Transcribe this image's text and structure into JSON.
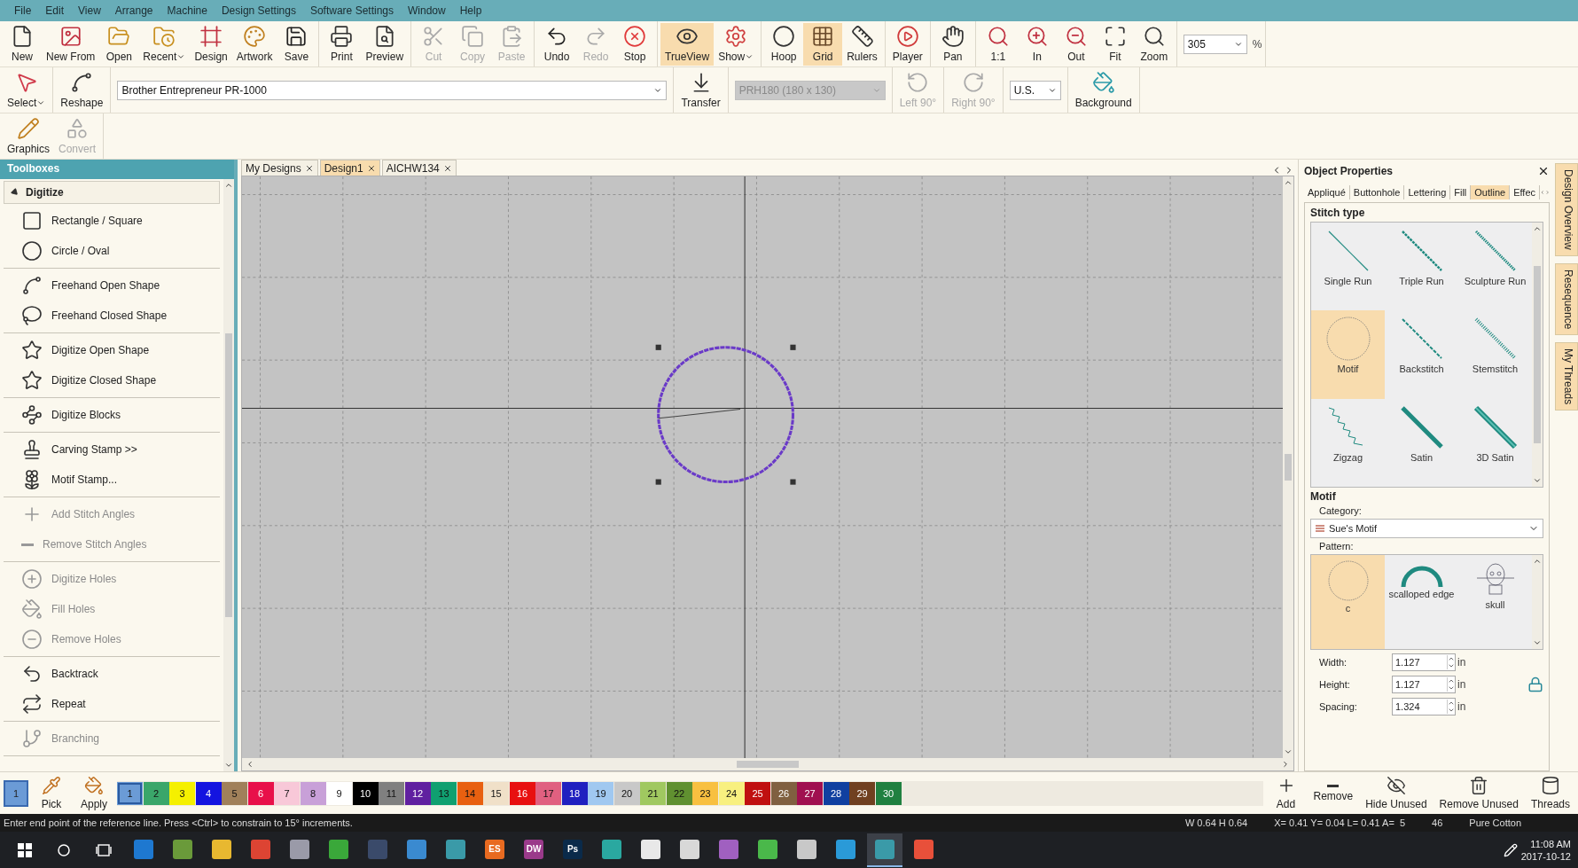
{
  "menu": [
    "File",
    "Edit",
    "View",
    "Arrange",
    "Machine",
    "Design Settings",
    "Software Settings",
    "Window",
    "Help"
  ],
  "toolbar": [
    [
      {
        "label": "New",
        "disabled": false,
        "selected": false,
        "dropdown": false
      },
      {
        "label": "New From",
        "disabled": false,
        "selected": false,
        "dropdown": false
      },
      {
        "label": "Open",
        "disabled": false,
        "selected": false,
        "dropdown": false
      },
      {
        "label": "Recent",
        "disabled": false,
        "selected": false,
        "dropdown": true
      },
      {
        "label": "Design",
        "disabled": false,
        "selected": false,
        "dropdown": false
      },
      {
        "label": "Artwork",
        "disabled": false,
        "selected": false,
        "dropdown": false
      },
      {
        "label": "Save",
        "disabled": false,
        "selected": false,
        "dropdown": false
      }
    ],
    [
      {
        "label": "Print",
        "disabled": false,
        "selected": false,
        "dropdown": false
      },
      {
        "label": "Preview",
        "disabled": false,
        "selected": false,
        "dropdown": false
      }
    ],
    [
      {
        "label": "Cut",
        "disabled": true,
        "selected": false,
        "dropdown": false
      },
      {
        "label": "Copy",
        "disabled": true,
        "selected": false,
        "dropdown": false
      },
      {
        "label": "Paste",
        "disabled": true,
        "selected": false,
        "dropdown": false
      }
    ],
    [
      {
        "label": "Undo",
        "disabled": false,
        "selected": false,
        "dropdown": false
      },
      {
        "label": "Redo",
        "disabled": true,
        "selected": false,
        "dropdown": false
      },
      {
        "label": "Stop",
        "disabled": false,
        "selected": false,
        "dropdown": false
      }
    ],
    [
      {
        "label": "TrueView",
        "disabled": false,
        "selected": true,
        "dropdown": false
      },
      {
        "label": "Show",
        "disabled": false,
        "selected": false,
        "dropdown": true
      }
    ],
    [
      {
        "label": "Hoop",
        "disabled": false,
        "selected": false,
        "dropdown": false
      },
      {
        "label": "Grid",
        "disabled": false,
        "selected": true,
        "dropdown": false
      },
      {
        "label": "Rulers",
        "disabled": false,
        "selected": false,
        "dropdown": false
      }
    ],
    [
      {
        "label": "Player",
        "disabled": false,
        "selected": false,
        "dropdown": false
      }
    ],
    [
      {
        "label": "Pan",
        "disabled": false,
        "selected": false,
        "dropdown": false
      }
    ],
    [
      {
        "label": "1:1",
        "disabled": false,
        "selected": false,
        "dropdown": false
      },
      {
        "label": "In",
        "disabled": false,
        "selected": false,
        "dropdown": false
      },
      {
        "label": "Out",
        "disabled": false,
        "selected": false,
        "dropdown": false
      },
      {
        "label": "Fit",
        "disabled": false,
        "selected": false,
        "dropdown": false
      },
      {
        "label": "Zoom",
        "disabled": false,
        "selected": false,
        "dropdown": false
      }
    ]
  ],
  "zoom": {
    "value": "305",
    "unit": "%"
  },
  "toolbar_2": [
    {
      "kind": "button",
      "label": "Select",
      "disabled": false,
      "dropdown": true
    },
    {
      "kind": "button",
      "label": "Reshape",
      "disabled": false,
      "dropdown": false
    },
    {
      "kind": "select",
      "value": "Brother Entrepreneur PR-1000",
      "disabled": false,
      "wide": true
    },
    {
      "kind": "button",
      "label": "Transfer",
      "disabled": false,
      "dropdown": false
    },
    {
      "kind": "select",
      "value": "PRH180 (180 x 130)",
      "disabled": true,
      "wide": false
    },
    {
      "kind": "button",
      "label": "Left 90°",
      "disabled": true,
      "dropdown": false
    },
    {
      "kind": "button",
      "label": "Right 90°",
      "disabled": true,
      "dropdown": false
    },
    {
      "kind": "select",
      "value": "U.S.",
      "disabled": false,
      "wide": false
    },
    {
      "kind": "button",
      "label": "Background",
      "disabled": false,
      "dropdown": false
    }
  ],
  "toolbar_3": [
    {
      "label": "Graphics",
      "disabled": false
    },
    {
      "label": "Convert",
      "disabled": true
    }
  ],
  "toolboxes": {
    "title": "Toolboxes",
    "section": "Digitize",
    "expanded": true,
    "groups": [
      [
        {
          "label": "Rectangle / Square",
          "disabled": false
        },
        {
          "label": "Circle / Oval",
          "disabled": false
        }
      ],
      [
        {
          "label": "Freehand Open Shape",
          "disabled": false
        },
        {
          "label": "Freehand Closed Shape",
          "disabled": false
        }
      ],
      [
        {
          "label": "Digitize Open Shape",
          "disabled": false
        },
        {
          "label": "Digitize Closed Shape",
          "disabled": false
        }
      ],
      [
        {
          "label": "Digitize Blocks",
          "disabled": false
        }
      ],
      [
        {
          "label": "Carving Stamp >>",
          "disabled": false
        },
        {
          "label": "Motif Stamp...",
          "disabled": false
        }
      ],
      [
        {
          "label": "Add Stitch Angles",
          "disabled": true
        },
        {
          "label": "Remove Stitch Angles",
          "disabled": true
        }
      ],
      [
        {
          "label": "Digitize Holes",
          "disabled": true
        },
        {
          "label": "Fill Holes",
          "disabled": true
        },
        {
          "label": "Remove Holes",
          "disabled": true
        }
      ],
      [
        {
          "label": "Backtrack",
          "disabled": false
        },
        {
          "label": "Repeat",
          "disabled": false
        }
      ],
      [
        {
          "label": "Branching",
          "disabled": true
        }
      ]
    ]
  },
  "doc_tabs": [
    {
      "label": "My Designs",
      "selected": false
    },
    {
      "label": "Design1",
      "selected": true
    },
    {
      "label": "AICHW134",
      "selected": false
    }
  ],
  "properties": {
    "title": "Object Properties",
    "tabs": [
      {
        "label": "Appliqué",
        "selected": false
      },
      {
        "label": "Buttonhole",
        "selected": false
      },
      {
        "label": "Lettering",
        "selected": false
      },
      {
        "label": "Fill",
        "selected": false
      },
      {
        "label": "Outline",
        "selected": true
      },
      {
        "label": "Effec",
        "selected": false
      }
    ],
    "stitch_heading": "Stitch type",
    "stitch_types": [
      {
        "kind": "single",
        "label": "Single Run",
        "selected": false
      },
      {
        "kind": "triple",
        "label": "Triple Run",
        "selected": false
      },
      {
        "kind": "sculpture",
        "label": "Sculpture Run",
        "selected": false
      },
      {
        "kind": "motif",
        "label": "Motif",
        "selected": true
      },
      {
        "kind": "backstitch",
        "label": "Backstitch",
        "selected": false
      },
      {
        "kind": "stemstitch",
        "label": "Stemstitch",
        "selected": false
      },
      {
        "kind": "zigzag",
        "label": "Zigzag",
        "selected": false
      },
      {
        "kind": "satin",
        "label": "Satin",
        "selected": false
      },
      {
        "kind": "satin3d",
        "label": "3D Satin",
        "selected": false
      }
    ],
    "motif_heading": "Motif",
    "category_label": "Category:",
    "category": "Sue's Motif",
    "pattern_label": "Pattern:",
    "patterns": [
      {
        "kind": "circle",
        "label": "c",
        "selected": true
      },
      {
        "kind": "arc",
        "label": "scalloped edge",
        "selected": false
      },
      {
        "kind": "sketch",
        "label": "skull",
        "selected": false
      }
    ],
    "fields": [
      {
        "label": "Width:",
        "value": "1.127",
        "unit": "in"
      },
      {
        "label": "Height:",
        "value": "1.127",
        "unit": "in"
      },
      {
        "label": "Spacing:",
        "value": "1.324",
        "unit": "in"
      }
    ],
    "locked": true
  },
  "side_tabs": [
    "Design Overview",
    "Resequence",
    "My Threads"
  ],
  "current_color": {
    "label": "1",
    "color": "#6b9bd6"
  },
  "color_tools": [
    "Pick",
    "Apply"
  ],
  "palette": [
    {
      "label": "1",
      "color": "#6b9bd6",
      "selected": true
    },
    {
      "label": "2",
      "color": "#3aa66a",
      "selected": false
    },
    {
      "label": "3",
      "color": "#f5f000",
      "selected": false
    },
    {
      "label": "4",
      "color": "#1414e0",
      "selected": false
    },
    {
      "label": "5",
      "color": "#a0805a",
      "selected": false
    },
    {
      "label": "6",
      "color": "#e8104a",
      "selected": false
    },
    {
      "label": "7",
      "color": "#f8c8d8",
      "selected": false
    },
    {
      "label": "8",
      "color": "#c8a0d8",
      "selected": false
    },
    {
      "label": "9",
      "color": "#ffffff",
      "selected": false
    },
    {
      "label": "10",
      "color": "#000000",
      "selected": false
    },
    {
      "label": "11",
      "color": "#808080",
      "selected": false
    },
    {
      "label": "12",
      "color": "#6020a0",
      "selected": false
    },
    {
      "label": "13",
      "color": "#10a070",
      "selected": false
    },
    {
      "label": "14",
      "color": "#e86010",
      "selected": false
    },
    {
      "label": "15",
      "color": "#f0e0c8",
      "selected": false
    },
    {
      "label": "16",
      "color": "#e81010",
      "selected": false
    },
    {
      "label": "17",
      "color": "#e06080",
      "selected": false
    },
    {
      "label": "18",
      "color": "#2020c0",
      "selected": false
    },
    {
      "label": "19",
      "color": "#a0c8f0",
      "selected": false
    },
    {
      "label": "20",
      "color": "#c8c8c8",
      "selected": false
    },
    {
      "label": "21",
      "color": "#a0c860",
      "selected": false
    },
    {
      "label": "22",
      "color": "#609030",
      "selected": false
    },
    {
      "label": "23",
      "color": "#f8c040",
      "selected": false
    },
    {
      "label": "24",
      "color": "#f8f080",
      "selected": false
    },
    {
      "label": "25",
      "color": "#c01010",
      "selected": false
    },
    {
      "label": "26",
      "color": "#806040",
      "selected": false
    },
    {
      "label": "27",
      "color": "#a01050",
      "selected": false
    },
    {
      "label": "28",
      "color": "#1040a0",
      "selected": false
    },
    {
      "label": "29",
      "color": "#704020",
      "selected": false
    },
    {
      "label": "30",
      "color": "#208040",
      "selected": false
    }
  ],
  "thread_tools": [
    "Add",
    "Remove",
    "Hide Unused",
    "Remove Unused",
    "Threads"
  ],
  "status_bar": {
    "message": "Enter end point of the reference line. Press <Ctrl> to constrain to 15° increments.",
    "size": "W 0.64 H 0.64",
    "position": "X= 0.41 Y= 0.04 L= 0.41 A=  5",
    "count": "46",
    "thread": "Pure Cotton"
  },
  "taskbar": {
    "apps": [
      {
        "color": "#1e78d0",
        "selected": false
      },
      {
        "color": "#6a9a3a",
        "selected": false
      },
      {
        "color": "#e8b830",
        "selected": false
      },
      {
        "color": "#dd4433",
        "selected": false
      },
      {
        "color": "#9a9aa8",
        "selected": false
      },
      {
        "color": "#3aa83a",
        "selected": false
      },
      {
        "color": "#3a4a6a",
        "selected": false
      },
      {
        "color": "#3a8ad0",
        "selected": false
      },
      {
        "color": "#3a9aa8",
        "selected": false
      },
      {
        "color": "#e86a20",
        "label": "ES",
        "selected": false
      },
      {
        "color": "#9a3a8a",
        "label": "DW",
        "selected": false
      },
      {
        "color": "#0a2a4a",
        "label": "Ps",
        "selected": false
      },
      {
        "color": "#2aa8a0",
        "selected": false
      },
      {
        "color": "#e8e8e8",
        "selected": false
      },
      {
        "color": "#d8d8d8",
        "selected": false
      },
      {
        "color": "#a060c0",
        "selected": false
      },
      {
        "color": "#4ab84a",
        "selected": false
      },
      {
        "color": "#c8c8c8",
        "selected": false
      },
      {
        "color": "#2a9ad8",
        "selected": false
      },
      {
        "color": "#3a9aa8",
        "selected": true
      },
      {
        "color": "#e8503a",
        "selected": false
      }
    ],
    "time": "11:08 AM",
    "date": "2017-10-12"
  }
}
